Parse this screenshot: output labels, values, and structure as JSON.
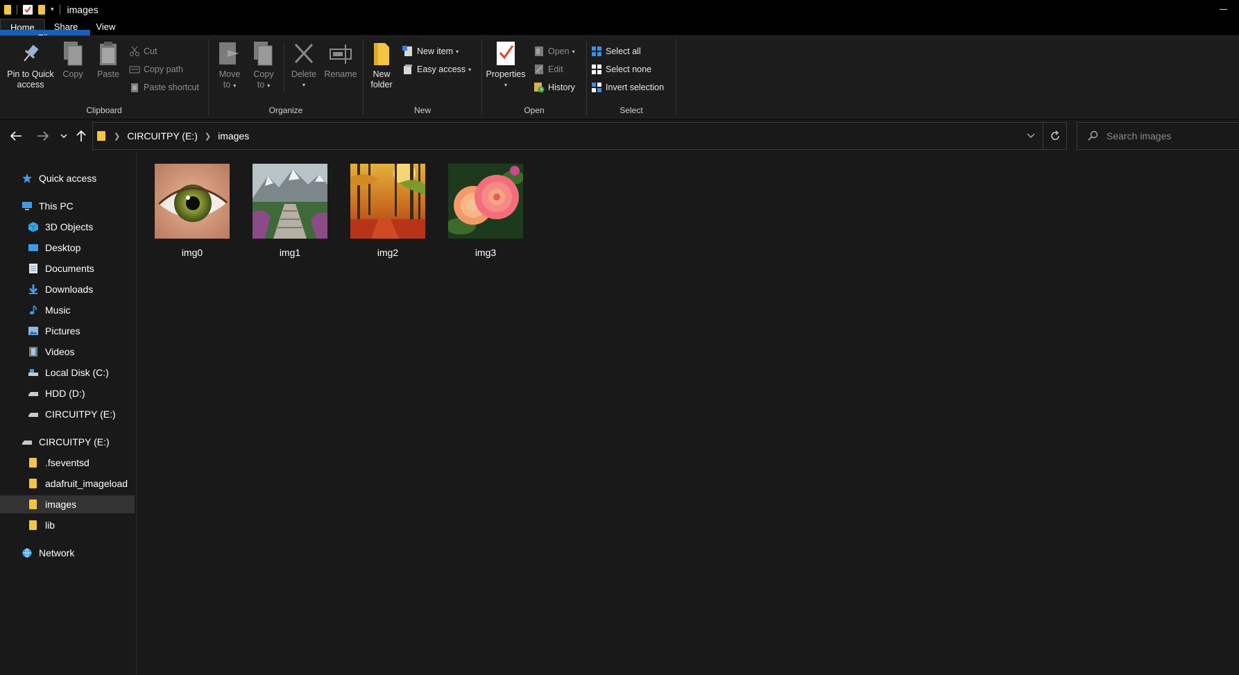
{
  "titlebar": {
    "title": "images"
  },
  "tabs": [
    {
      "label": "File"
    },
    {
      "label": "Home"
    },
    {
      "label": "Share"
    },
    {
      "label": "View"
    }
  ],
  "ribbon": {
    "clipboard": {
      "label": "Clipboard",
      "pin": "Pin to Quick access",
      "pin_line1": "Pin to Quick",
      "pin_line2": "access",
      "copy": "Copy",
      "paste": "Paste",
      "cut": "Cut",
      "copy_path": "Copy path",
      "paste_shortcut": "Paste shortcut"
    },
    "organize": {
      "label": "Organize",
      "move_to_1": "Move",
      "move_to_2": "to",
      "copy_to_1": "Copy",
      "copy_to_2": "to",
      "delete": "Delete",
      "rename": "Rename"
    },
    "new": {
      "label": "New",
      "new_folder_1": "New",
      "new_folder_2": "folder",
      "new_item": "New item",
      "easy_access": "Easy access"
    },
    "open": {
      "label": "Open",
      "properties": "Properties",
      "open": "Open",
      "edit": "Edit",
      "history": "History"
    },
    "select": {
      "label": "Select",
      "select_all": "Select all",
      "select_none": "Select none",
      "invert_selection": "Invert selection"
    }
  },
  "address": {
    "crumbs": [
      "CIRCUITPY (E:)",
      "images"
    ],
    "search_placeholder": "Search images"
  },
  "navpane": {
    "quick_access": "Quick access",
    "this_pc": "This PC",
    "pc_items": [
      "3D Objects",
      "Desktop",
      "Documents",
      "Downloads",
      "Music",
      "Pictures",
      "Videos",
      "Local Disk (C:)",
      "HDD (D:)",
      "CIRCUITPY (E:)"
    ],
    "drive": "CIRCUITPY (E:)",
    "drive_items": [
      ".fseventsd",
      "adafruit_imageload",
      "images",
      "lib"
    ],
    "selected": "images",
    "network": "Network"
  },
  "files": [
    {
      "name": "img0",
      "subject": "eye"
    },
    {
      "name": "img1",
      "subject": "mountain-path"
    },
    {
      "name": "img2",
      "subject": "autumn-forest"
    },
    {
      "name": "img3",
      "subject": "rose"
    }
  ],
  "colors": {
    "accent": "#1a5fb4",
    "folder": "#f4c542",
    "background": "#191919",
    "ribbon": "#1c1c1c"
  }
}
